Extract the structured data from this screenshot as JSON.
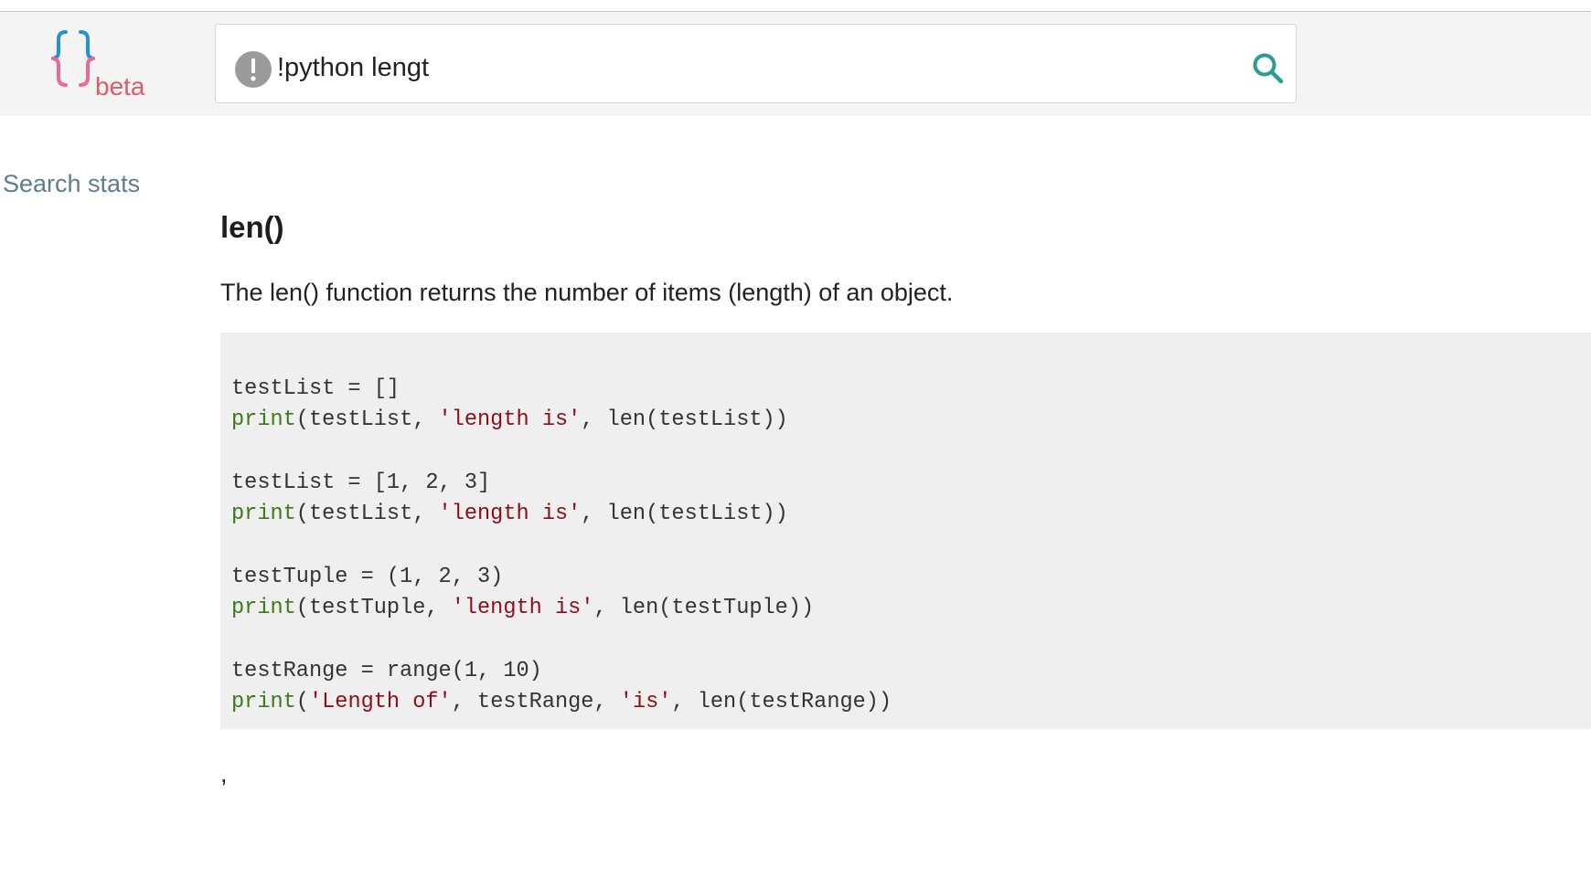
{
  "logo": {
    "label": "beta",
    "brace_top_color": "#2b8fd6",
    "brace_bottom_color": "#e86a9a",
    "label_color": "#e05a65"
  },
  "search": {
    "query": "!python lengt",
    "bang_icon": "exclamation-circle-icon",
    "submit_icon": "search-icon",
    "accent_color": "#2a9d8f"
  },
  "sidebar": {
    "search_stats_label": "Search stats"
  },
  "result": {
    "title": "len()",
    "description": "The len() function returns the number of items (length) of an object.",
    "code_lines": [
      [
        {
          "t": "plain",
          "s": "testList = []"
        }
      ],
      [
        {
          "t": "kw",
          "s": "print"
        },
        {
          "t": "plain",
          "s": "(testList, "
        },
        {
          "t": "str",
          "s": "'length is'"
        },
        {
          "t": "plain",
          "s": ", len(testList))"
        }
      ],
      [],
      [
        {
          "t": "plain",
          "s": "testList = [1, 2, 3]"
        }
      ],
      [
        {
          "t": "kw",
          "s": "print"
        },
        {
          "t": "plain",
          "s": "(testList, "
        },
        {
          "t": "str",
          "s": "'length is'"
        },
        {
          "t": "plain",
          "s": ", len(testList))"
        }
      ],
      [],
      [
        {
          "t": "plain",
          "s": "testTuple = (1, 2, 3)"
        }
      ],
      [
        {
          "t": "kw",
          "s": "print"
        },
        {
          "t": "plain",
          "s": "(testTuple, "
        },
        {
          "t": "str",
          "s": "'length is'"
        },
        {
          "t": "plain",
          "s": ", len(testTuple))"
        }
      ],
      [],
      [
        {
          "t": "plain",
          "s": "testRange = range(1, 10)"
        }
      ],
      [
        {
          "t": "kw",
          "s": "print"
        },
        {
          "t": "plain",
          "s": "("
        },
        {
          "t": "str",
          "s": "'Length of'"
        },
        {
          "t": "plain",
          "s": ", testRange, "
        },
        {
          "t": "str",
          "s": "'is'"
        },
        {
          "t": "plain",
          "s": ", len(testRange))"
        }
      ]
    ],
    "trailing_text": ","
  }
}
